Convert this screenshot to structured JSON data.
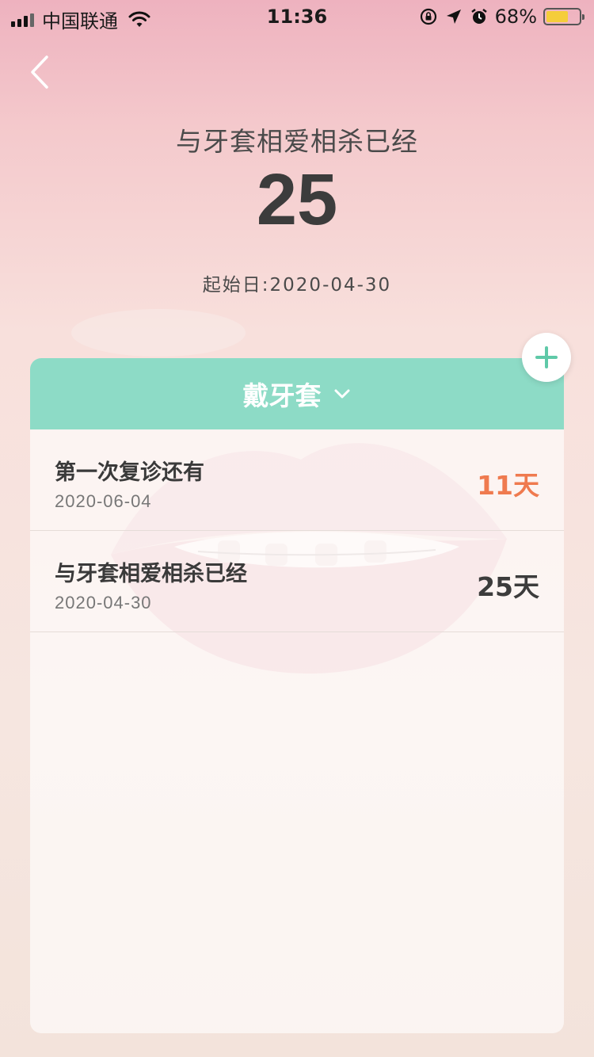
{
  "status_bar": {
    "carrier": "中国联通",
    "time": "11:36",
    "battery_percent": "68%",
    "battery_level": 0.68,
    "battery_color": "#f5cd3a"
  },
  "header": {
    "title": "与牙套相爱相杀已经",
    "count": "25",
    "start_date": "起始日:2020-04-30"
  },
  "card": {
    "header_label": "戴牙套",
    "accent_color": "#8ddbc6",
    "rows": [
      {
        "title": "第一次复诊还有",
        "date": "2020-06-04",
        "value": "11天",
        "value_color": "#ef7a4f"
      },
      {
        "title": "与牙套相爱相杀已经",
        "date": "2020-04-30",
        "value": "25天",
        "value_color": "#3c3c3c"
      }
    ]
  },
  "icons": {
    "back": "chevron-left-icon",
    "add": "plus-icon",
    "dropdown": "chevron-down-icon"
  }
}
